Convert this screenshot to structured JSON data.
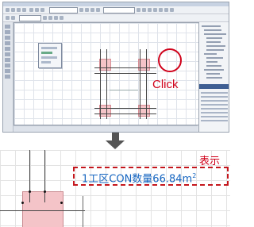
{
  "app": {
    "toolbar_icons": [
      "select-icon",
      "line-icon",
      "rectangle-icon",
      "circle-icon",
      "zoom-icon",
      "pan-icon",
      "measure-icon",
      "settings-icon"
    ]
  },
  "annotations": {
    "click": "Click",
    "display": "表示",
    "quantity_text": "1工区CON数量66.84m",
    "quantity_unit_sup": "2"
  },
  "colors": {
    "annotation_red": "#d0021b",
    "quantity_blue": "#1565c0",
    "pad_pink": "#f4c4c8",
    "arrow_gray": "#555555"
  }
}
